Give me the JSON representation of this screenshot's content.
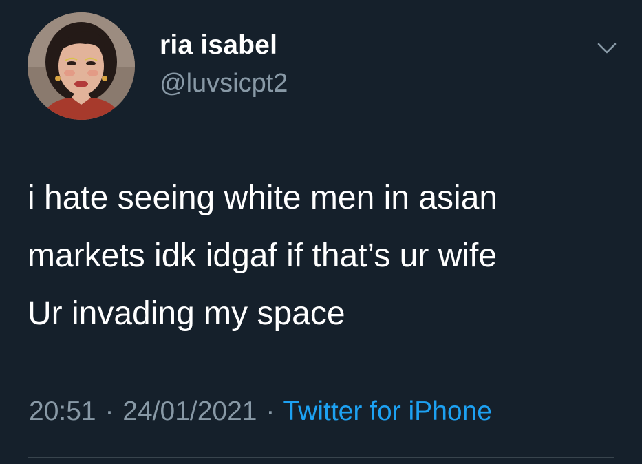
{
  "tweet": {
    "author": {
      "display_name": "ria isabel",
      "handle": "@luvsicpt2"
    },
    "text_lines": [
      "i hate seeing white men in asian",
      "markets idk idgaf if that’s ur wife",
      "Ur invading my space"
    ],
    "meta": {
      "time": "20:51",
      "separator": "·",
      "date": "24/01/2021",
      "source": "Twitter for iPhone"
    },
    "more_icon": "chevron-down-icon"
  },
  "colors": {
    "background": "#15202b",
    "primary_text": "#ffffff",
    "secondary_text": "#8899a6",
    "link": "#1da1f2",
    "divider": "#38444d"
  }
}
